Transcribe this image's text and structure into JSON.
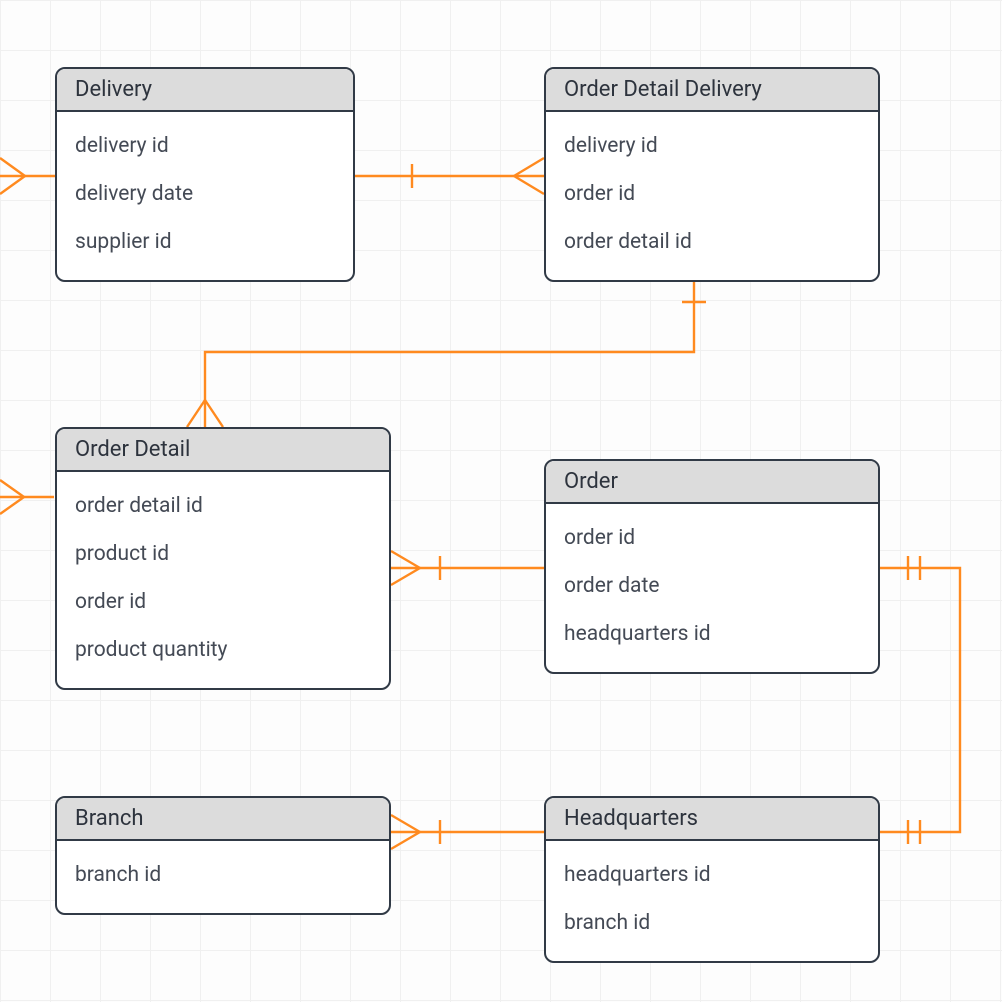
{
  "entities": {
    "delivery": {
      "title": "Delivery",
      "attrs": [
        "delivery id",
        "delivery date",
        "supplier id"
      ]
    },
    "orderDetailDelivery": {
      "title": "Order Detail Delivery",
      "attrs": [
        "delivery id",
        "order id",
        "order detail id"
      ]
    },
    "orderDetail": {
      "title": "Order Detail",
      "attrs": [
        "order detail id",
        "product id",
        "order id",
        "product quantity"
      ]
    },
    "order": {
      "title": "Order",
      "attrs": [
        "order id",
        "order date",
        "headquarters id"
      ]
    },
    "branch": {
      "title": "Branch",
      "attrs": [
        "branch id"
      ]
    },
    "headquarters": {
      "title": "Headquarters",
      "attrs": [
        "headquarters id",
        "branch id"
      ]
    }
  },
  "relationships": [
    {
      "from": "Delivery",
      "to": "(offscreen left)",
      "type": "one-to-many"
    },
    {
      "from": "Delivery",
      "to": "Order Detail Delivery",
      "type": "one-to-many"
    },
    {
      "from": "Order Detail Delivery",
      "to": "Order Detail",
      "type": "many-to-one"
    },
    {
      "from": "Order Detail",
      "to": "(offscreen left)",
      "type": "one-to-many"
    },
    {
      "from": "Order Detail",
      "to": "Order",
      "type": "many-to-one"
    },
    {
      "from": "Order",
      "to": "Headquarters",
      "type": "one-to-one"
    },
    {
      "from": "Branch",
      "to": "Headquarters",
      "type": "many-to-one"
    }
  ],
  "colors": {
    "connector": "#ff8a1f",
    "entityBorder": "#313a46",
    "headerBg": "#dcdcdc"
  }
}
